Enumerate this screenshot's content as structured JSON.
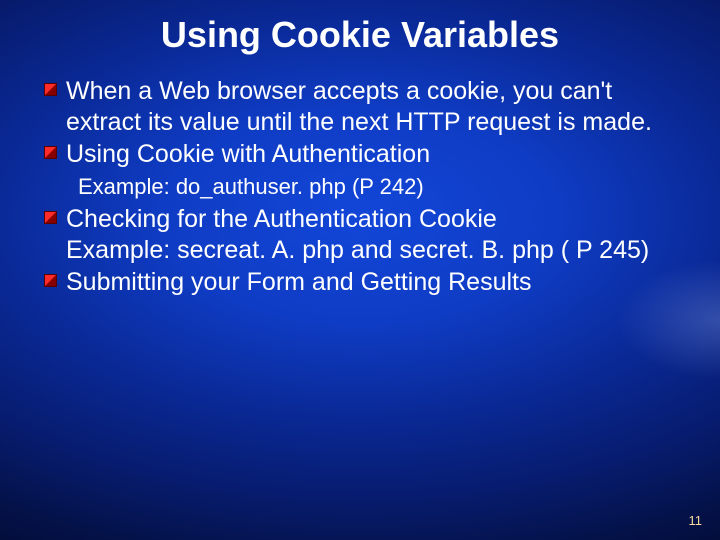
{
  "title": "Using Cookie Variables",
  "items": [
    {
      "type": "bullet",
      "text": "When a Web browser accepts a cookie, you can't extract its value until the next HTTP request is made."
    },
    {
      "type": "bullet",
      "text": "Using Cookie with Authentication"
    },
    {
      "type": "sub",
      "text": "Example: do_authuser. php (P 242)"
    },
    {
      "type": "bullet",
      "text": "Checking for the Authentication Cookie"
    },
    {
      "type": "cont",
      "text": "Example: secreat. A. php and secret. B. php ( P 245)"
    },
    {
      "type": "bullet",
      "text": "Submitting your Form and Getting Results"
    }
  ],
  "page_number": "11"
}
